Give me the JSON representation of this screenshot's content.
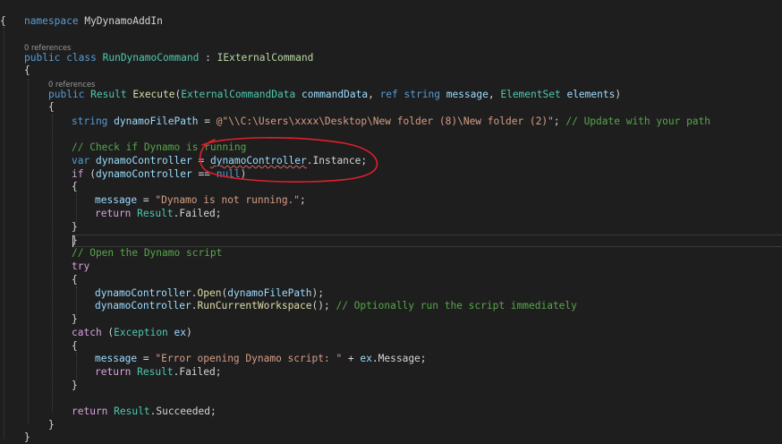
{
  "codelens": {
    "class_refs": "0 references",
    "method_refs": "0 references"
  },
  "code": {
    "namespace_kw": "namespace",
    "namespace_name": "MyDynamoAddIn",
    "open_brace": "{",
    "close_brace": "}",
    "public_kw": "public",
    "class_kw": "class",
    "class_name": "RunDynamoCommand",
    "colon": " : ",
    "interface_name": "IExternalCommand",
    "result_type": "Result",
    "method_name": "Execute",
    "param_type1": "ExternalCommandData",
    "param_name1": "commandData",
    "ref_kw": "ref",
    "string_kw": "string",
    "param_name2": "message",
    "param_type3": "ElementSet",
    "param_name3": "elements",
    "var_filepath": "dynamoFilePath",
    "filepath_value": "@\"\\\\C:\\Users\\xxxx\\Desktop\\New folder (8)\\New folder (2)\"",
    "filepath_comment": "// Update with your path",
    "comment_check": "// Check if Dynamo is running",
    "var_kw": "var",
    "var_controller": "dynamoController",
    "controller_class": "dynamoController",
    "instance_prop": "Instance",
    "if_kw": "if",
    "null_kw": "null",
    "msg_not_running": "\"Dynamo is not running.\"",
    "return_kw": "return",
    "failed_member": "Failed",
    "comment_open": "// Open the Dynamo script",
    "try_kw": "try",
    "open_method": "Open",
    "run_method": "RunCurrentWorkspace",
    "comment_run": "// Optionally run the script immediately",
    "catch_kw": "catch",
    "exception_type": "Exception",
    "ex_var": "ex",
    "msg_error": "\"Error opening Dynamo script: \"",
    "message_prop": "Message",
    "succeeded_member": "Succeeded"
  },
  "colors": {
    "background": "#1e1e1e",
    "keyword": "#569cd6",
    "control": "#d8a0df",
    "type": "#4ec9b0",
    "interface": "#b8d7a3",
    "method": "#dcdcaa",
    "variable": "#9cdcfe",
    "string": "#d69d85",
    "comment": "#57a64a",
    "annotation_stroke": "#e0202a"
  }
}
